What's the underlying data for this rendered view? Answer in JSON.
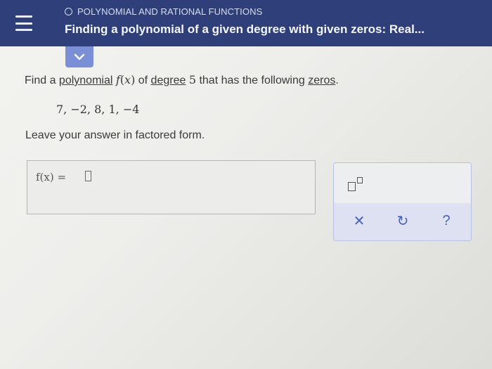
{
  "header": {
    "topic": "POLYNOMIAL AND RATIONAL FUNCTIONS",
    "title": "Finding a polynomial of a given degree with given zeros: Real..."
  },
  "question": {
    "prefix": "Find a ",
    "link1": "polynomial",
    "func": "f",
    "var": "x",
    "mid": " of ",
    "link2": "degree",
    "degree_value": "5",
    "suffix": " that has the following ",
    "link3": "zeros",
    "end": "."
  },
  "zeros": "7,  −2,  8,  1,  −4",
  "instruction": "Leave your answer in factored form.",
  "answer": {
    "label": "f(x) =",
    "value": ""
  },
  "tools": {
    "clear": "✕",
    "undo": "↻",
    "help": "?"
  },
  "icons": {
    "menu": "hamburger-menu-icon",
    "expand": "chevron-down-icon",
    "exponent": "exponent-template-icon",
    "clear": "close-icon",
    "undo": "undo-icon",
    "help": "question-icon"
  },
  "colors": {
    "header_bg": "#2e3f7a",
    "expand_tab": "#7a8fd6",
    "tool_accent": "#4a63b8"
  }
}
